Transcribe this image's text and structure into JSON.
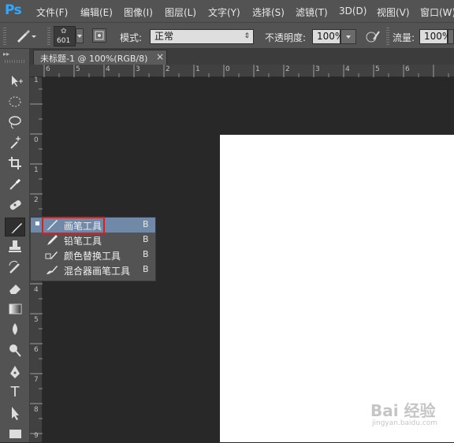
{
  "app": {
    "logo": "Ps"
  },
  "menu": [
    "文件(F)",
    "编辑(E)",
    "图像(I)",
    "图层(L)",
    "文字(Y)",
    "选择(S)",
    "滤镜(T)",
    "3D(D)",
    "视图(V)",
    "窗口(W)"
  ],
  "options": {
    "brush_size": "601",
    "mode_label": "模式:",
    "mode_value": "正常",
    "opacity_label": "不透明度:",
    "opacity_value": "100%",
    "flow_label": "流量:",
    "flow_value": "100%"
  },
  "document_tab": {
    "title": "未标题-1 @ 100%(RGB/8)",
    "close": "×"
  },
  "ruler_top": [
    "6",
    "5",
    "4",
    "3",
    "2",
    "1",
    "0",
    "1",
    "2",
    "3",
    "4",
    "5",
    "6"
  ],
  "ruler_left": [
    "1",
    "0",
    "1",
    "2",
    "3",
    "4",
    "5",
    "6",
    "7",
    "8",
    "9"
  ],
  "toolbar": {
    "tools": [
      "move-tool",
      "marquee-tool",
      "lasso-tool",
      "magic-wand-tool",
      "crop-tool",
      "eyedropper-tool",
      "healing-brush-tool",
      "brush-tool",
      "clone-stamp-tool",
      "history-brush-tool",
      "eraser-tool",
      "gradient-tool",
      "blur-tool",
      "dodge-tool",
      "pen-tool",
      "type-tool",
      "path-selection-tool",
      "rectangle-tool"
    ],
    "type_glyph": "T"
  },
  "flyout": {
    "items": [
      {
        "label": "画笔工具",
        "key": "B",
        "icon": "brush-icon",
        "selected": true
      },
      {
        "label": "铅笔工具",
        "key": "B",
        "icon": "pencil-icon",
        "selected": false
      },
      {
        "label": "颜色替换工具",
        "key": "B",
        "icon": "color-replacement-icon",
        "selected": false
      },
      {
        "label": "混合器画笔工具",
        "key": "B",
        "icon": "mixer-brush-icon",
        "selected": false
      }
    ],
    "bullet": "▪"
  },
  "watermark": {
    "main": "Bai 经验",
    "sub": "jingyan.baidu.com"
  },
  "colors": {
    "selection": "#7189a9",
    "highlight": "#d92020",
    "ps_blue": "#31a8ff"
  }
}
